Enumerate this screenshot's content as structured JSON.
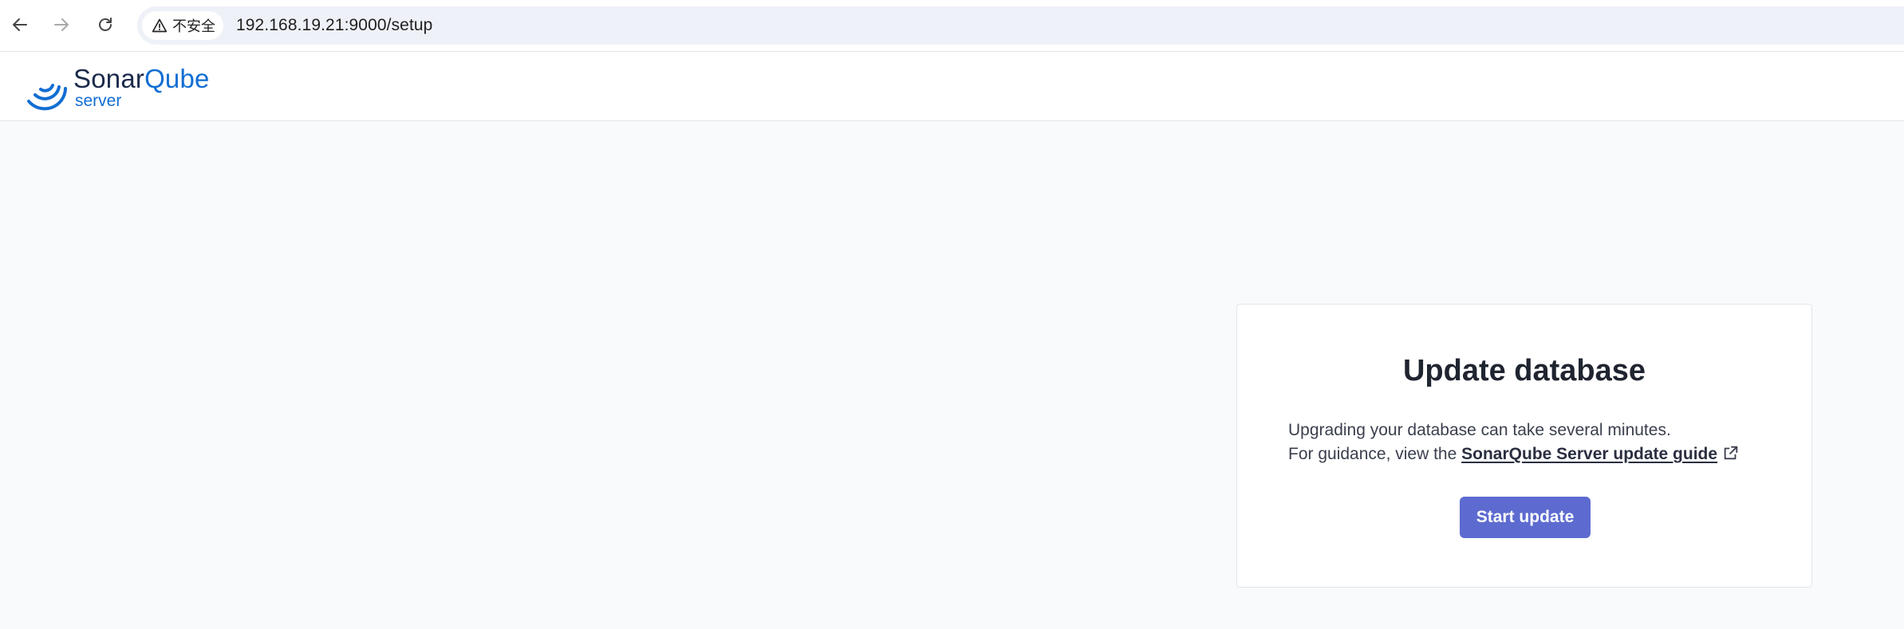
{
  "browser": {
    "security_label": "不安全",
    "url": "192.168.19.21:9000/setup",
    "icons": {
      "back": "arrow-left-icon",
      "forward": "arrow-right-icon",
      "reload": "reload-icon",
      "security": "warning-triangle-icon"
    }
  },
  "header": {
    "logo_primary_a": "Sonar",
    "logo_primary_b": "Qube",
    "logo_secondary": "server"
  },
  "card": {
    "title": "Update database",
    "line1": "Upgrading your database can take several minutes.",
    "line2_prefix": "For guidance, view the",
    "link_label": "SonarQube Server update guide",
    "button_label": "Start update"
  },
  "colors": {
    "accent": "#5d6bd0",
    "brand_blue": "#126ed3",
    "brand_dark": "#1b2a4a",
    "page_bg": "#f9fafc"
  }
}
